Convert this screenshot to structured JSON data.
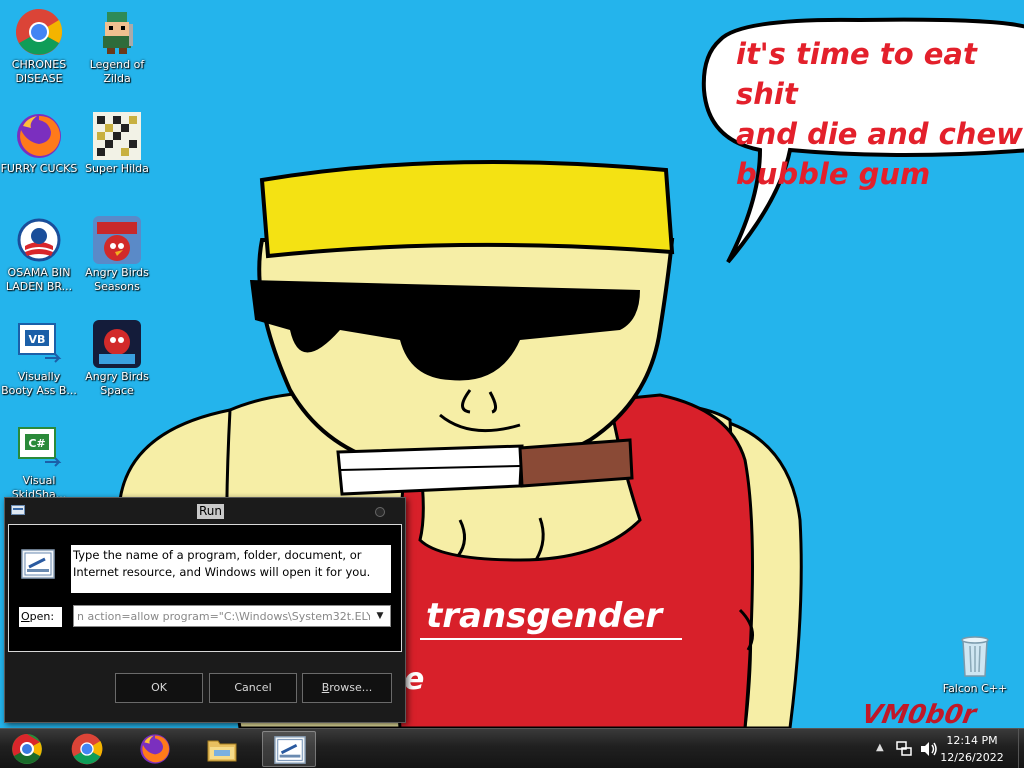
{
  "wallpaper": {
    "speech_bubble_text": "it's time to eat shit\nand die and chew\nbubble gum",
    "shirt_text": "transgender",
    "shirt_fragment": "e",
    "signature": "VM0b0r"
  },
  "desktop_icons": [
    {
      "label": "CHRONES\nDISEASE",
      "icon": "chrome-icon"
    },
    {
      "label": "Legend of\nZilda",
      "icon": "zelda-character-icon"
    },
    {
      "label": "FURRY CUCKS",
      "icon": "firefox-icon"
    },
    {
      "label": "Super Hilda",
      "icon": "pixel-game-icon"
    },
    {
      "label": "OSAMA BIN\nLADEN BR...",
      "icon": "obama-logo-icon"
    },
    {
      "label": "Angry Birds\nSeasons",
      "icon": "angry-birds-seasons-icon"
    },
    {
      "label": "Visually\nBooty Ass B...",
      "icon": "visual-basic-icon"
    },
    {
      "label": "Angry Birds\nSpace",
      "icon": "angry-birds-space-icon"
    },
    {
      "label": "Visual\nSkidSha...",
      "icon": "visual-csharp-icon"
    },
    {
      "label": "Falcon C++",
      "icon": "recycle-bin-icon"
    }
  ],
  "run_dialog": {
    "title": "Run",
    "description": "Type the name of a program, folder, document, or\nInternet resource, and Windows will open it for you.",
    "open_label": "Open:",
    "open_label_accel": "O",
    "open_label_rest": "pen:",
    "input_value": "n action=allow program=\"C:\\Windows\\System32t.ELY",
    "ok_label": "OK",
    "cancel_label": "Cancel",
    "browse_label": "Browse...",
    "browse_accel": "B",
    "browse_rest": "rowse..."
  },
  "taskbar": {
    "items": [
      "start-orb",
      "chrome",
      "firefox",
      "file-explorer",
      "run"
    ],
    "clock_time": "12:14 PM",
    "clock_date": "12/26/2022"
  },
  "colors": {
    "desktop_bg": "#24b4ec",
    "speech_text": "#e3202b",
    "shirt_red": "#d8202a",
    "hat_yellow": "#f4e213",
    "skin": "#f6eea6"
  }
}
